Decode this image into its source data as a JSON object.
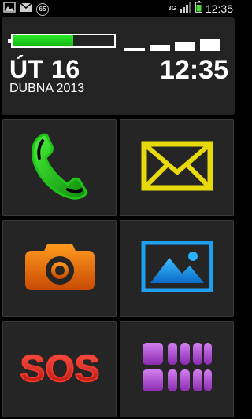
{
  "statusbar": {
    "notification_count": "65",
    "network": "3G",
    "clock": "12:35",
    "icons": [
      "photo-icon",
      "mail-icon",
      "badge-icon",
      "signal-icon",
      "battery-icon"
    ]
  },
  "header": {
    "battery_level": 0.6,
    "signal_bars": 4,
    "day": "ÚT 16",
    "date": "DUBNA 2013",
    "time": "12:35"
  },
  "tiles": [
    {
      "name": "phone",
      "icon": "phone-icon",
      "color": "#22d41a"
    },
    {
      "name": "messages",
      "icon": "envelope-icon",
      "color": "#e8d90a"
    },
    {
      "name": "camera",
      "icon": "camera-icon",
      "color": "#f07a10"
    },
    {
      "name": "gallery",
      "icon": "picture-icon",
      "color": "#1ea0f0"
    },
    {
      "name": "sos",
      "label": "SOS",
      "icon": "sos-icon",
      "color": "#e4201a"
    },
    {
      "name": "apps",
      "icon": "app-grid-icon",
      "color": "#b24fd6"
    }
  ],
  "colors": {
    "background": "#000000",
    "panel": "#232323",
    "tile": "#252525"
  }
}
